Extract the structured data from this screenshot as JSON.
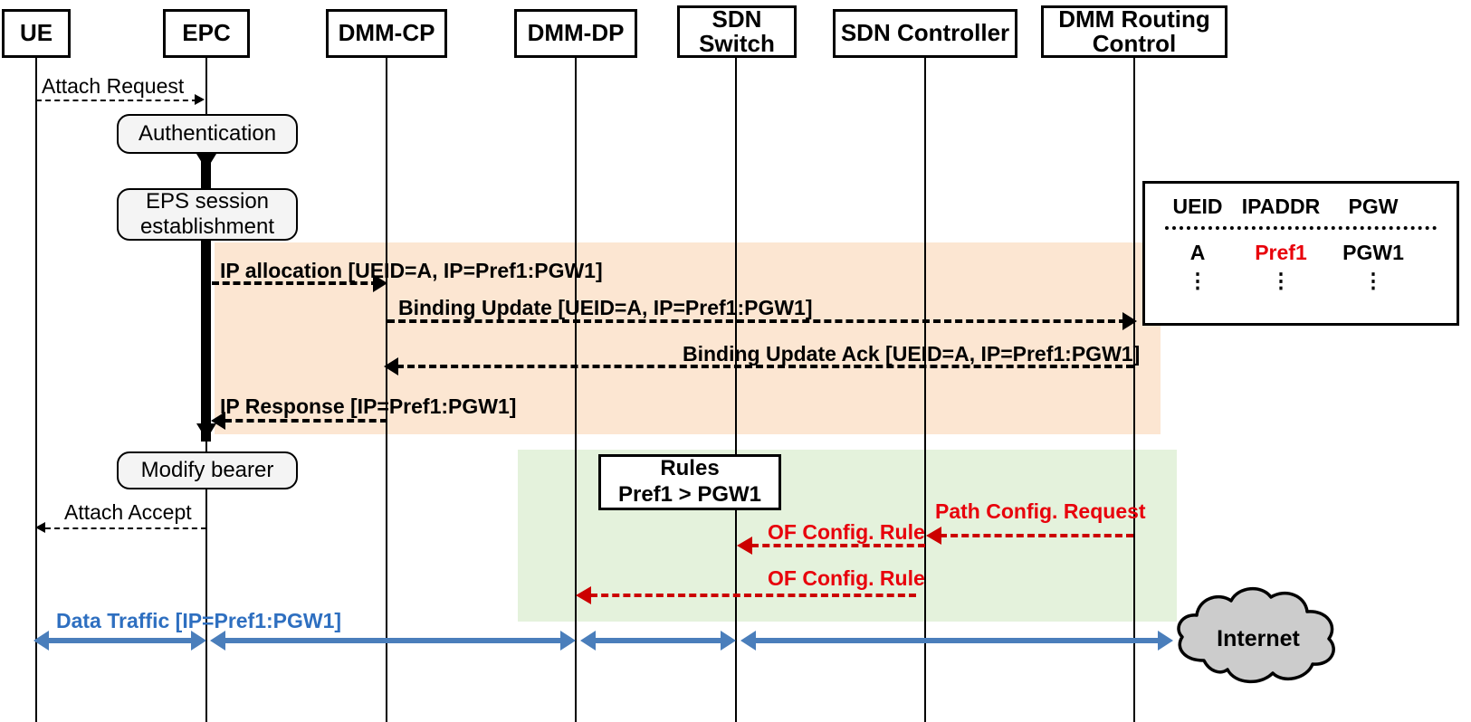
{
  "title": "DMM SDN Attach Procedure Sequence Diagram",
  "colors": {
    "band_orange": "#FCE6D2",
    "band_green": "#E4F2DC",
    "red_accent": "#E8000B",
    "blue_accent": "#2E6FC0",
    "cloud_fill": "#CCCCCC"
  },
  "actors": [
    {
      "id": "ue",
      "label": "UE"
    },
    {
      "id": "epc",
      "label": "EPC"
    },
    {
      "id": "dmmcp",
      "label": "DMM-CP"
    },
    {
      "id": "dmmdp",
      "label": "DMM-DP"
    },
    {
      "id": "sdnsw",
      "label": "SDN\nSwitch"
    },
    {
      "id": "sdnctl",
      "label": "SDN Controller"
    },
    {
      "id": "dmmrc",
      "label": "DMM Routing\nControl"
    }
  ],
  "actor_labels": {
    "ue": "UE",
    "epc": "EPC",
    "dmmcp": "DMM-CP",
    "dmmdp": "DMM-DP",
    "sdnsw_line1": "SDN",
    "sdnsw_line2": "Switch",
    "sdnctl": "SDN Controller",
    "dmmrc_line1": "DMM Routing",
    "dmmrc_line2": "Control"
  },
  "process_boxes": {
    "authentication": "Authentication",
    "eps_session_line1": "EPS session",
    "eps_session_line2": "establishment",
    "modify_bearer": "Modify bearer"
  },
  "rules_box": {
    "title": "Rules",
    "rule": "Pref1  >  PGW1"
  },
  "binding_table": {
    "headers": [
      "UEID",
      "IPADDR",
      "PGW"
    ],
    "rows": [
      {
        "ueid": "A",
        "ipaddr": "Pref1",
        "pgw": "PGW1",
        "ipaddr_highlighted": true
      }
    ],
    "continuation": "⋮"
  },
  "messages": [
    {
      "id": "attach_request",
      "label": "Attach Request",
      "from": "ue",
      "to": "epc",
      "style": "dashed-thin"
    },
    {
      "id": "ip_allocation",
      "label": "IP allocation  [UEID=A, IP=Pref1:PGW1]",
      "from": "epc",
      "to": "dmmcp",
      "style": "dashed-bold"
    },
    {
      "id": "binding_update",
      "label": "Binding Update [UEID=A, IP=Pref1:PGW1]",
      "from": "dmmcp",
      "to": "dmmrc",
      "style": "dashed-bold"
    },
    {
      "id": "binding_update_ack",
      "label": "Binding Update Ack [UEID=A, IP=Pref1:PGW1]",
      "from": "dmmrc",
      "to": "dmmcp",
      "style": "dashed-bold"
    },
    {
      "id": "ip_response",
      "label": "IP Response [IP=Pref1:PGW1]",
      "from": "dmmcp",
      "to": "epc",
      "style": "dashed-bold"
    },
    {
      "id": "attach_accept",
      "label": "Attach Accept",
      "from": "epc",
      "to": "ue",
      "style": "dashed-thin"
    },
    {
      "id": "path_config_request",
      "label": "Path Config. Request",
      "from": "dmmrc",
      "to": "sdnctl",
      "style": "dashed-red"
    },
    {
      "id": "of_config_rule_1",
      "label": "OF Config. Rule",
      "from": "sdnctl",
      "to": "sdnsw",
      "style": "dashed-red"
    },
    {
      "id": "of_config_rule_2",
      "label": "OF Config. Rule",
      "from": "sdnsw",
      "to": "dmmdp",
      "style": "dashed-red"
    },
    {
      "id": "data_traffic",
      "label": "Data Traffic [IP=Pref1:PGW1]",
      "from": "ue",
      "to": "internet",
      "style": "solid-blue-bidir"
    }
  ],
  "internet": {
    "label": "Internet"
  }
}
